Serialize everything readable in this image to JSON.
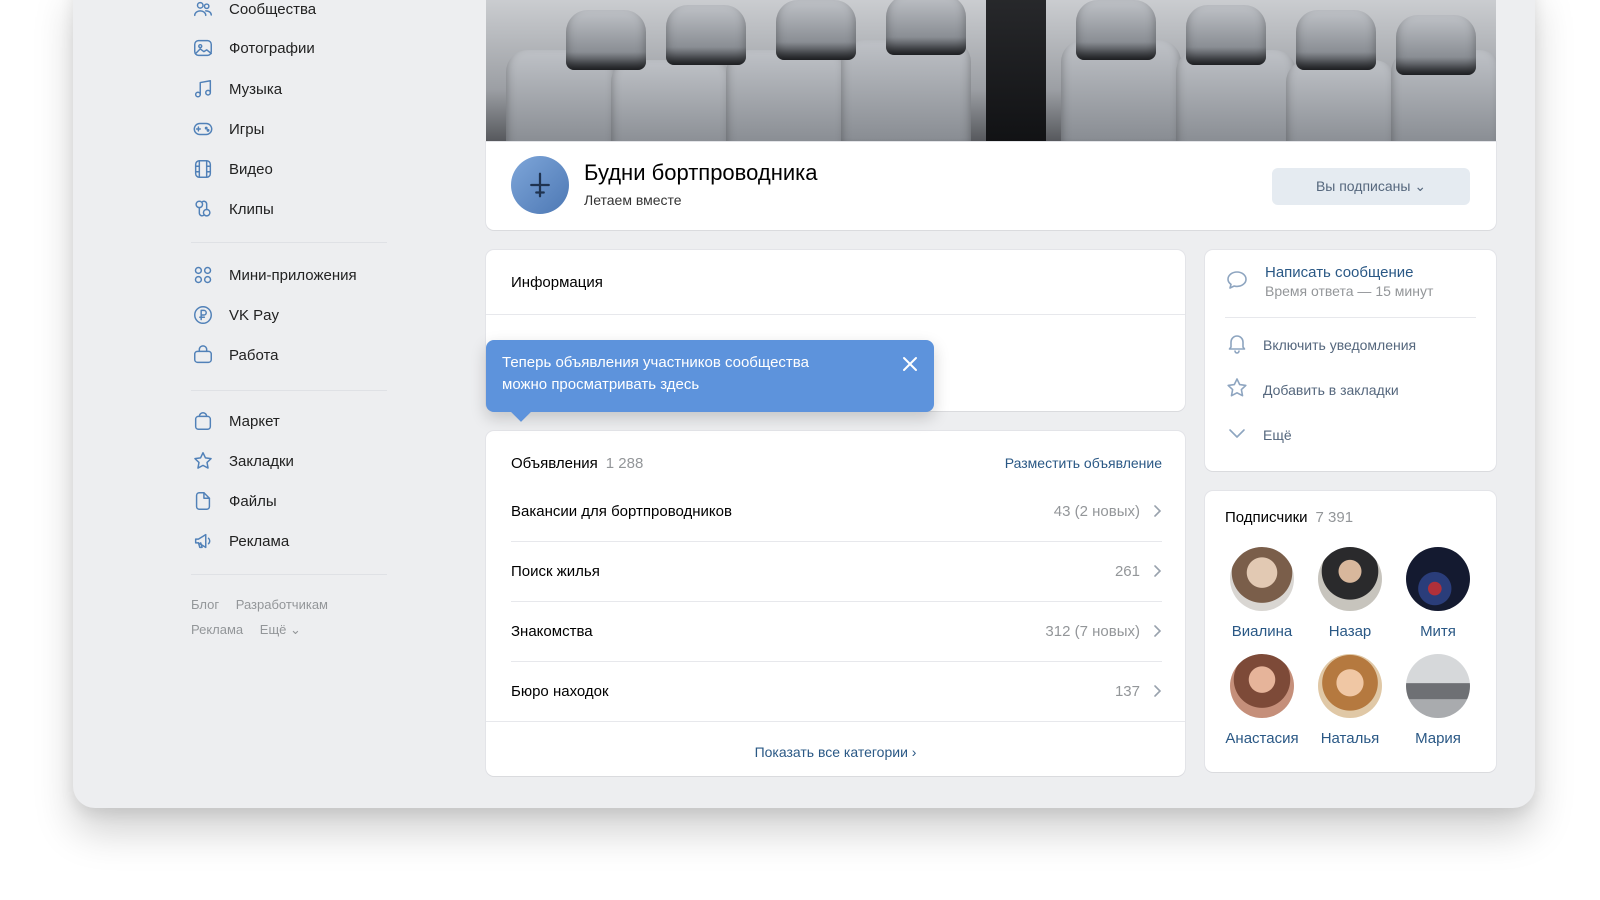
{
  "sidebar": {
    "items": [
      {
        "label": "Сообщества",
        "icon": "users-icon"
      },
      {
        "label": "Фотографии",
        "icon": "photo-icon"
      },
      {
        "label": "Музыка",
        "icon": "music-icon"
      },
      {
        "label": "Игры",
        "icon": "gamepad-icon"
      },
      {
        "label": "Видео",
        "icon": "video-icon"
      },
      {
        "label": "Клипы",
        "icon": "clips-icon"
      },
      {
        "label": "Мини-приложения",
        "icon": "apps-icon"
      },
      {
        "label": "VK Pay",
        "icon": "vkpay-icon"
      },
      {
        "label": "Работа",
        "icon": "briefcase-icon"
      },
      {
        "label": "Маркет",
        "icon": "shopping-bag-icon"
      },
      {
        "label": "Закладки",
        "icon": "star-icon"
      },
      {
        "label": "Файлы",
        "icon": "file-icon"
      },
      {
        "label": "Реклама",
        "icon": "megaphone-icon"
      }
    ],
    "footer": {
      "blog": "Блог",
      "dev": "Разработчикам",
      "ads": "Реклама",
      "more": "Ещё ⌄"
    }
  },
  "group": {
    "name": "Будни бортпроводника",
    "status": "Летаем вместе",
    "subscribe_label": "Вы подписаны ⌄",
    "avatar_icon": "airplane-icon"
  },
  "info": {
    "title": "Информация"
  },
  "tooltip": {
    "text_line1": "Теперь объявления участников сообщества",
    "text_line2": "можно просматривать здесь"
  },
  "ads": {
    "title": "Объявления",
    "count": "1 288",
    "post_label": "Разместить объявление",
    "rows": [
      {
        "name": "Вакансии для бортпроводников",
        "meta": "43 (2 новых)"
      },
      {
        "name": "Поиск жилья",
        "meta": "261"
      },
      {
        "name": "Знакомства",
        "meta": "312 (7 новых)"
      },
      {
        "name": "Бюро находок",
        "meta": "137"
      }
    ],
    "show_all": "Показать все категории ›"
  },
  "actions": {
    "message_title": "Написать сообщение",
    "message_sub": "Время ответа — 15 минут",
    "notify": "Включить уведомления",
    "bookmark": "Добавить в закладки",
    "more": "Ещё"
  },
  "subscribers": {
    "title": "Подписчики",
    "count": "7 391",
    "people": [
      {
        "name": "Виалина",
        "color": "#b9a89a"
      },
      {
        "name": "Назар",
        "color": "#2f2f32"
      },
      {
        "name": "Митя",
        "color": "#1b2440"
      },
      {
        "name": "Анастасия",
        "color": "#b98a7a"
      },
      {
        "name": "Наталья",
        "color": "#c9a27e"
      },
      {
        "name": "Мария",
        "color": "#8c8e92"
      }
    ]
  },
  "colors": {
    "accent": "#5181b8",
    "link": "#2a5885",
    "tooltip": "#5d93dc",
    "bg": "#edeef0"
  }
}
